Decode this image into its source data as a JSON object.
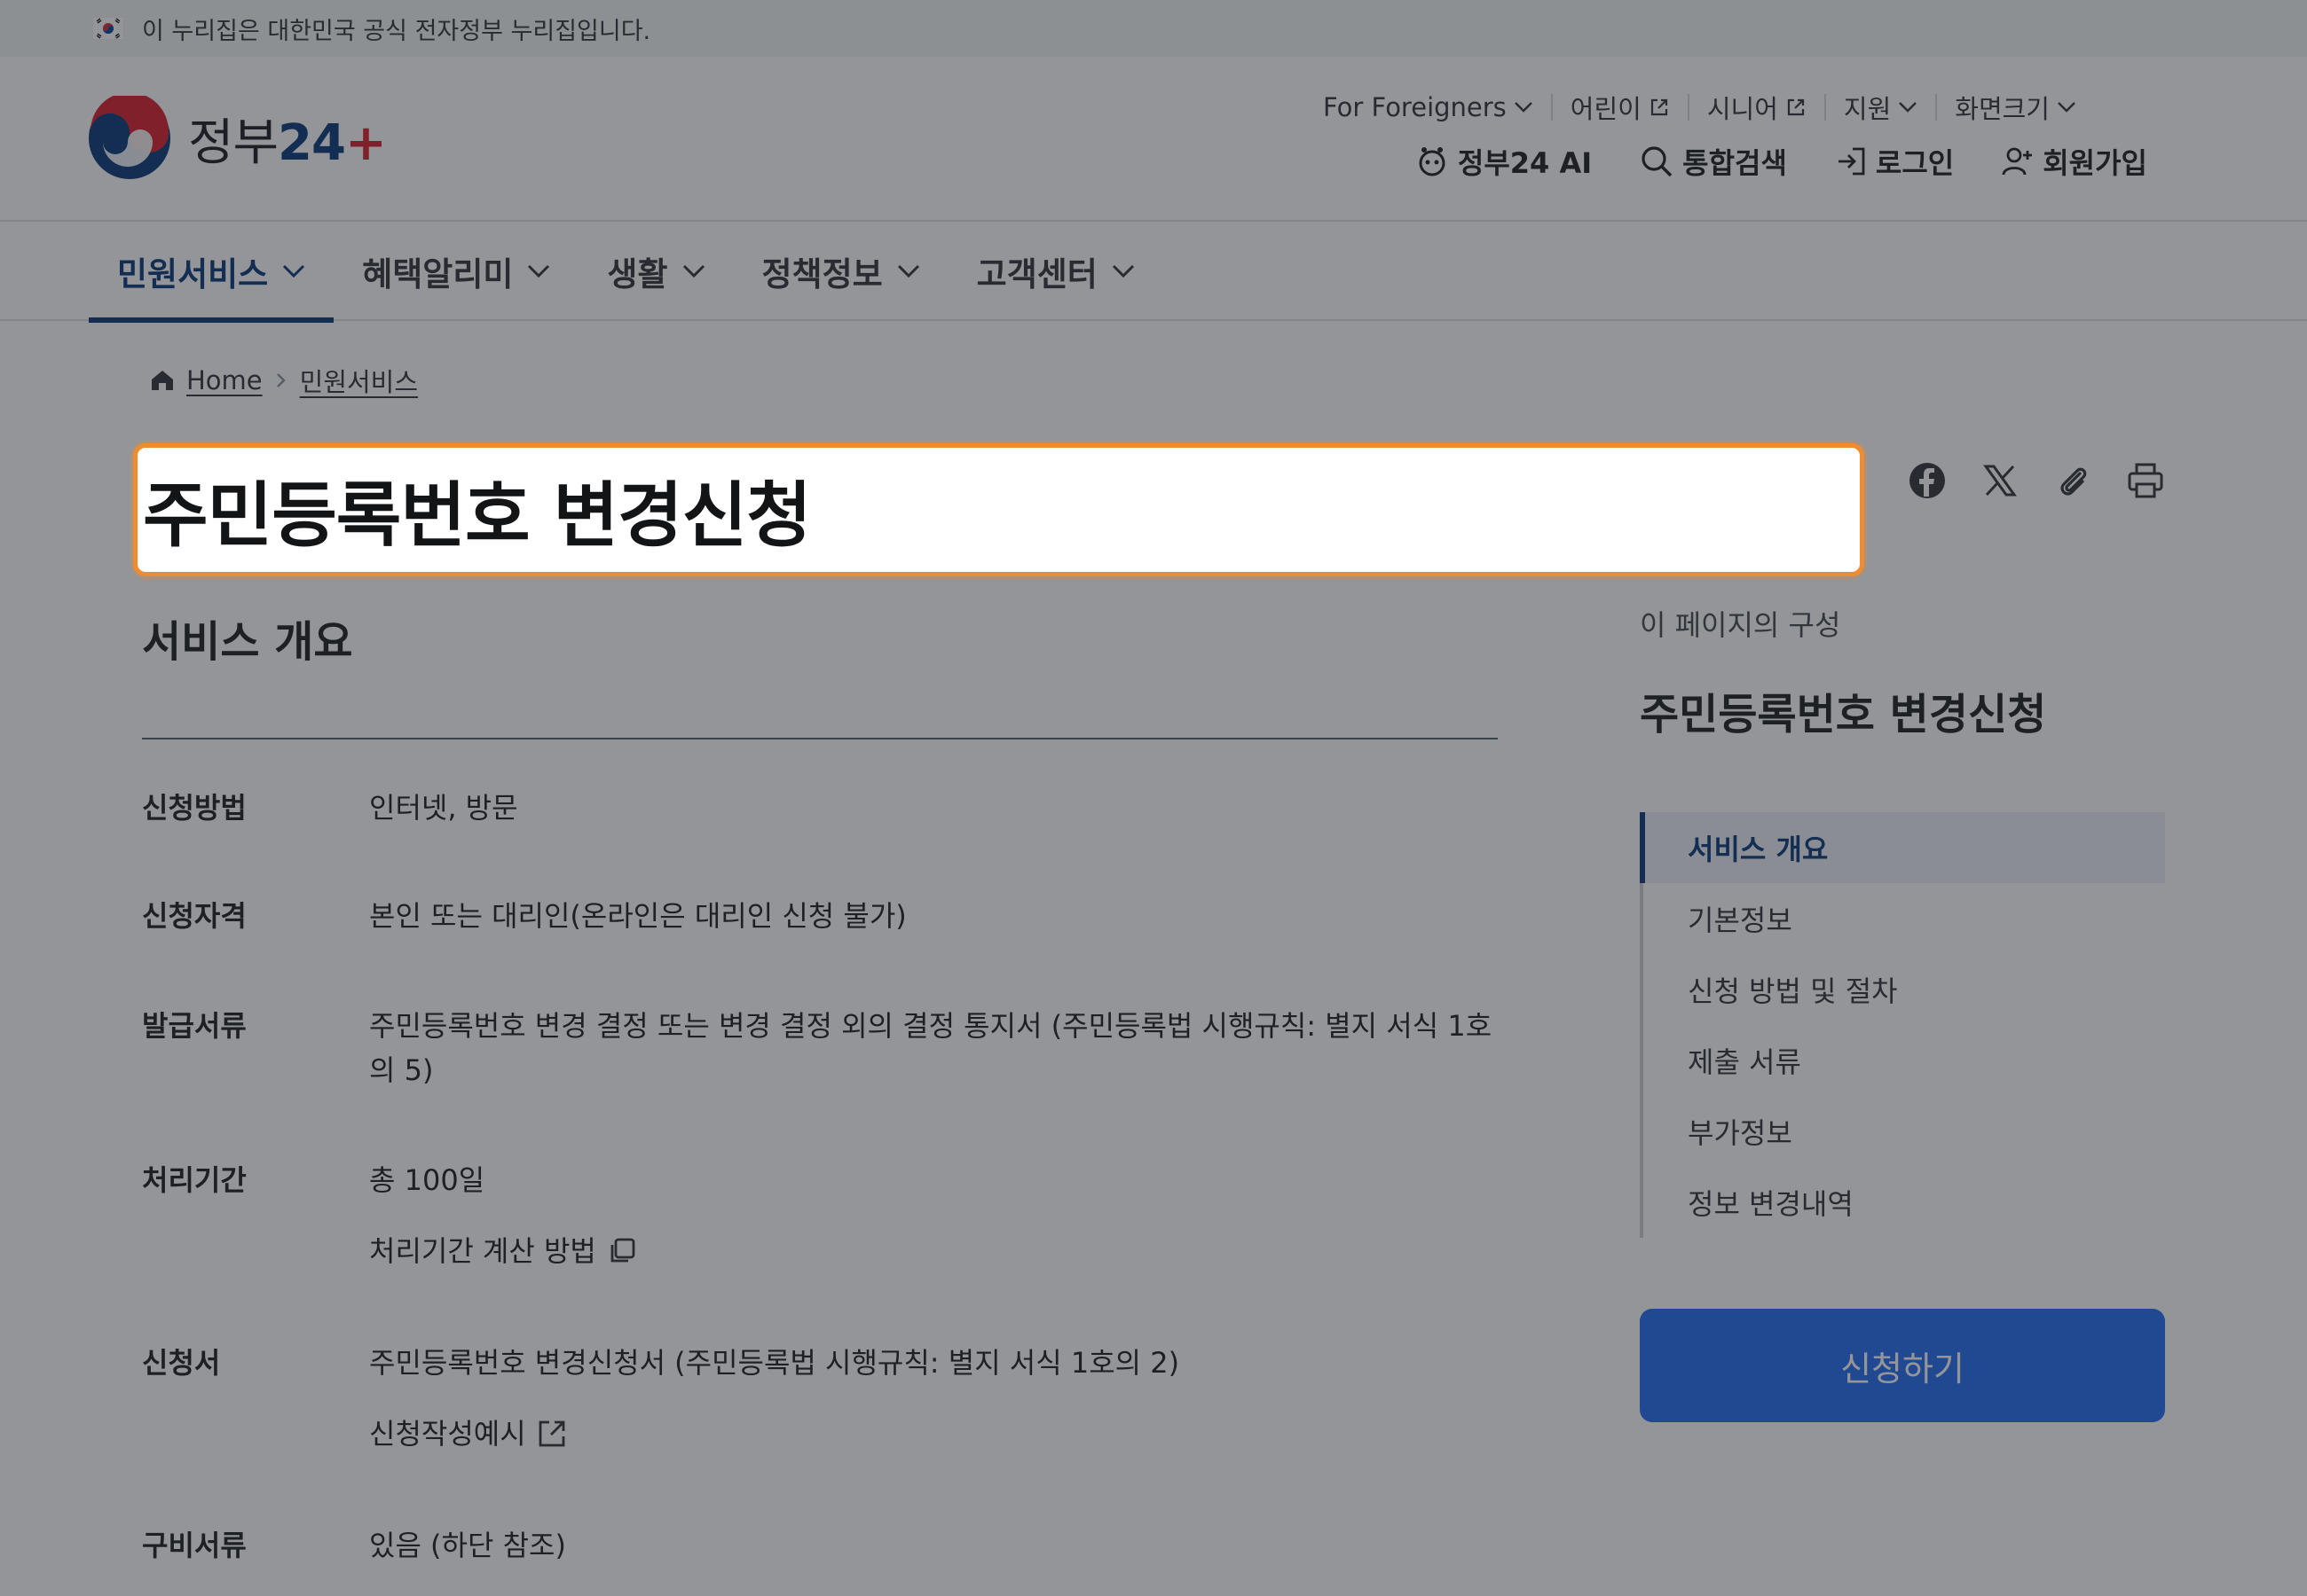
{
  "banner": {
    "text": "이 누리집은 대한민국 공식 전자정부 누리집입니다."
  },
  "logo": {
    "text_prefix": "정부",
    "text_num": "24"
  },
  "utility_top": {
    "foreigners": "For Foreigners",
    "kids": "어린이",
    "senior": "시니어",
    "support": "지원",
    "screen_size": "화면크기"
  },
  "utility_main": {
    "ai": "정부24 AI",
    "search": "통합검색",
    "login": "로그인",
    "signup": "회원가입"
  },
  "gnb": [
    {
      "label": "민원서비스",
      "active": true
    },
    {
      "label": "혜택알리미"
    },
    {
      "label": "생활"
    },
    {
      "label": "정책정보"
    },
    {
      "label": "고객센터"
    }
  ],
  "breadcrumb": {
    "home": "Home",
    "current": "민원서비스"
  },
  "page": {
    "title": "주민등록번호 변경신청"
  },
  "overview": {
    "title": "서비스 개요",
    "rows": [
      {
        "label": "신청방법",
        "value": "인터넷, 방문"
      },
      {
        "label": "신청자격",
        "value": "본인 또는 대리인(온라인은 대리인 신청 불가)"
      },
      {
        "label": "발급서류",
        "value": "주민등록번호 변경 결정 또는 변경 결정 외의 결정 통지서 (주민등록법 시행규칙: 별지 서식 1호의 5)"
      },
      {
        "label": "처리기간",
        "value": "총 100일",
        "sub": "처리기간 계산 방법"
      },
      {
        "label": "신청서",
        "value": "주민등록번호 변경신청서 (주민등록법 시행규칙: 별지 서식 1호의 2)",
        "sub": "신청작성예시"
      },
      {
        "label": "구비서류",
        "value": "있음 (하단 참조)"
      }
    ]
  },
  "toc": {
    "caption": "이 페이지의 구성",
    "title": "주민등록번호 변경신청",
    "items": [
      {
        "label": "서비스 개요",
        "active": true
      },
      {
        "label": "기본정보"
      },
      {
        "label": "신청 방법 및 절차"
      },
      {
        "label": "제출 서류"
      },
      {
        "label": "부가정보"
      },
      {
        "label": "정보 변경내역"
      }
    ]
  },
  "apply_button": {
    "label": "신청하기"
  },
  "colors": {
    "primary": "#0b3b7a",
    "accent_button": "#256ef4",
    "highlight": "#f08c2e"
  }
}
